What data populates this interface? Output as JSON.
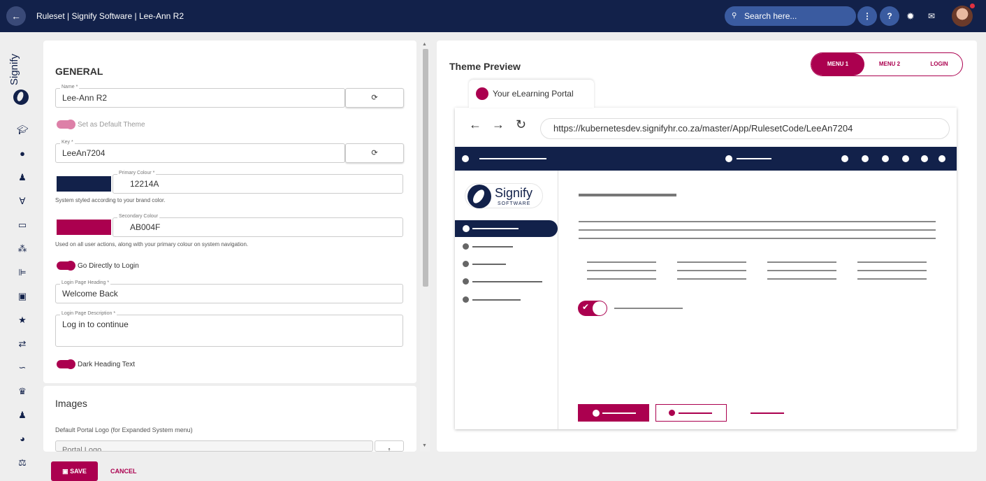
{
  "header": {
    "title": "Ruleset | Signify Software | Lee-Ann R2",
    "search_placeholder": "Search here...",
    "back_icon": "arrow-left-icon",
    "more_label": "⋮",
    "help_label": "?"
  },
  "brand": {
    "name": "Signify",
    "sub": "SOFTWARE"
  },
  "sidenav": {
    "icons": [
      "graduation-cap-icon",
      "compass-icon",
      "user-icon",
      "people-arrows-icon",
      "id-card-icon",
      "users-icon",
      "chart-icon",
      "calendar-icon",
      "star-icon",
      "route-icon",
      "handshake-icon",
      "crown-icon",
      "user-plus-icon",
      "pie-chart-icon",
      "scale-icon"
    ]
  },
  "general": {
    "heading": "GENERAL",
    "name_label": "Name *",
    "name_value": "Lee-Ann R2",
    "default_theme_label": "Set as Default Theme",
    "key_label": "Key *",
    "key_value": "LeeAn7204",
    "primary_label": "Primary Colour *",
    "primary_value": "12214A",
    "primary_hint": "System styled according to your brand color.",
    "secondary_label": "Secondary Colour",
    "secondary_value": "AB004F",
    "secondary_hint": "Used on all user actions, along with your primary colour on system navigation.",
    "go_login_label": "Go Directly to Login",
    "login_heading_label": "Login Page Heading *",
    "login_heading_value": "Welcome Back",
    "login_desc_label": "Login Page Description *",
    "login_desc_value": "Log in to continue",
    "dark_heading_label": "Dark Heading Text",
    "default_theme_on": false,
    "go_login_on": true,
    "dark_heading_on": true
  },
  "images": {
    "heading": "Images",
    "logo_label": "Default Portal Logo (for Expanded System menu)",
    "logo_value": "Portal Logo"
  },
  "preview": {
    "title": "Theme Preview",
    "menu": [
      "MENU 1",
      "MENU 2",
      "LOGIN"
    ],
    "tab_title": "Your eLearning Portal",
    "url": "https://kubernetesdev.signifyhr.co.za/master/App/RulesetCode/LeeAn7204",
    "logo_text": "Signify",
    "logo_sub": "SOFTWARE"
  },
  "footer": {
    "save_label": "SAVE",
    "cancel_label": "CANCEL"
  },
  "colors": {
    "primary": "#12214A",
    "secondary": "#AB004F"
  }
}
